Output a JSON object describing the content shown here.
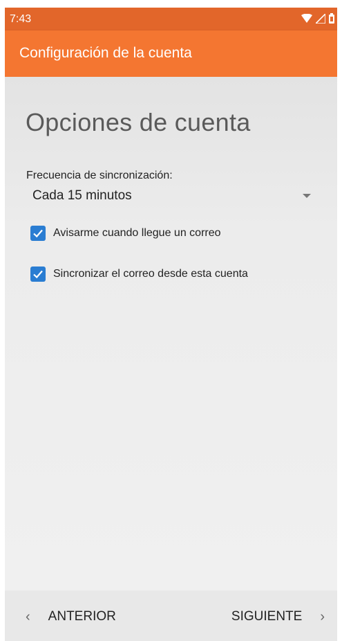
{
  "status_bar": {
    "time": "7:43",
    "icons": [
      "wifi-icon",
      "signal-icon",
      "battery-icon"
    ]
  },
  "app_bar": {
    "title": "Configuración de la cuenta",
    "color": "#f47631",
    "status_color": "#e2662a"
  },
  "main": {
    "heading": "Opciones de cuenta",
    "frequency": {
      "label": "Frecuencia de sincronización:",
      "value": "Cada 15 minutos"
    },
    "checkboxes": [
      {
        "label": "Avisarme cuando llegue un correo",
        "checked": true
      },
      {
        "label": "Sincronizar el correo desde esta cuenta",
        "checked": true
      }
    ],
    "accent_color": "#2a7dd2"
  },
  "nav": {
    "prev_label": "ANTERIOR",
    "next_label": "SIGUIENTE",
    "prev_icon": "chevron-left-icon",
    "next_icon": "chevron-right-icon"
  }
}
